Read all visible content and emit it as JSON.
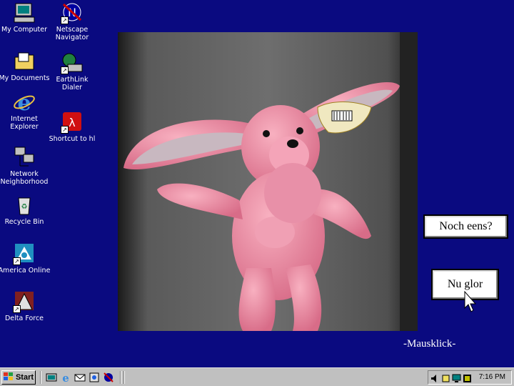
{
  "desktop": {
    "icons": [
      {
        "label": "My Computer"
      },
      {
        "label": "Netscape\nNavigator"
      },
      {
        "label": "My Documents"
      },
      {
        "label": "EarthLink\nDialer"
      },
      {
        "label": "Internet\nExplorer"
      },
      {
        "label": "Shortcut to hl"
      },
      {
        "label": "Network\nNeighborhood"
      },
      {
        "label": "Recycle Bin"
      },
      {
        "label": "America Online"
      },
      {
        "label": "Delta Force"
      }
    ]
  },
  "popups": {
    "first": "Noch eens?",
    "second": "Nu glor"
  },
  "caption": "-Mausklick-",
  "taskbar": {
    "start_label": "Start",
    "clock": "7:16 PM"
  },
  "colors": {
    "desktop": "#0a0a80",
    "taskbar": "#c0c0c0",
    "bunny": "#ee8fa6"
  }
}
